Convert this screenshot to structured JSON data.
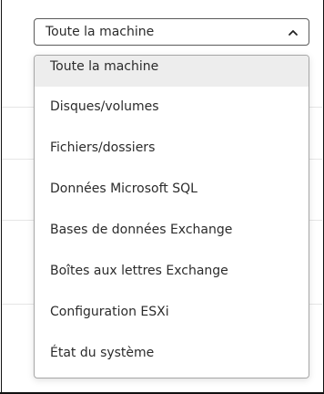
{
  "select": {
    "value": "Toute la machine",
    "icon": "chevron-up-icon"
  },
  "options": [
    {
      "label": "Toute la machine",
      "highlighted": true
    },
    {
      "label": "Disques/volumes"
    },
    {
      "label": "Fichiers/dossiers"
    },
    {
      "label": "Données Microsoft SQL"
    },
    {
      "label": "Bases de données Exchange"
    },
    {
      "label": "Boîtes aux lettres Exchange"
    },
    {
      "label": "Configuration ESXi"
    },
    {
      "label": "État du système"
    }
  ],
  "colors": {
    "highlight": "#ededed",
    "border": "#a6a6a6",
    "text": "#2b2b2b"
  }
}
